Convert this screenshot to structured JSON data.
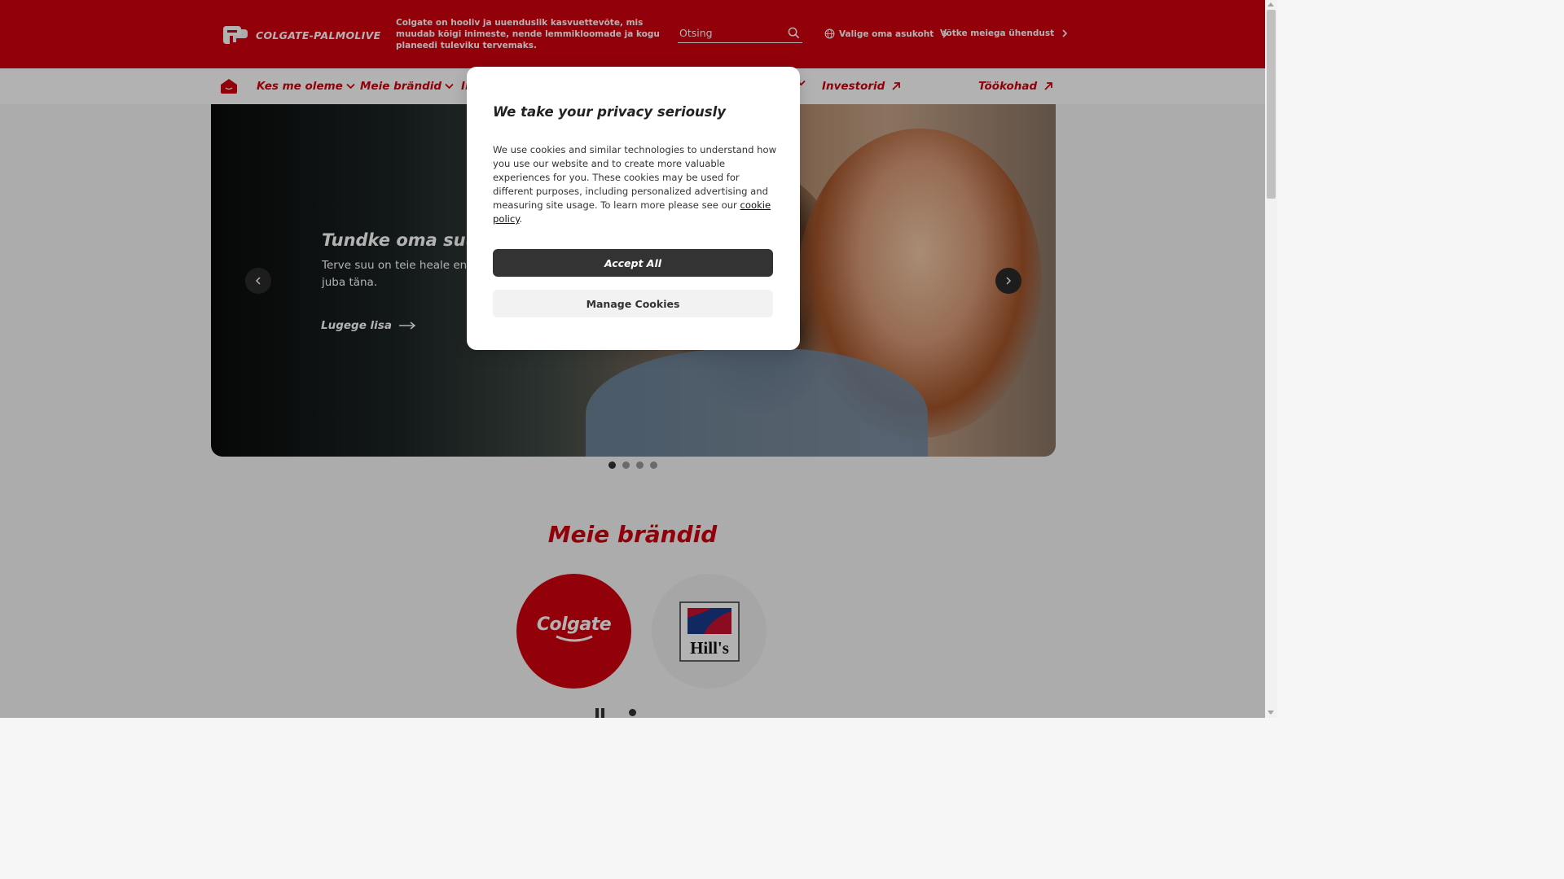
{
  "header": {
    "logo_text": "COLGATE-PALMOLIVE",
    "tagline": "Colgate on hooliv ja uuenduslik kasvuettevõte, mis muudab kõigi inimeste, nende lemmikloomade ja kogu planeedi tuleviku tervemaks.",
    "search_placeholder": "Otsing",
    "location_label": "Valige oma asukoht",
    "contact_label": "Võtke meiega ühendust"
  },
  "nav": {
    "items": [
      {
        "label": "Kes me oleme"
      },
      {
        "label": "Meie brändid"
      },
      {
        "label": "In"
      },
      {
        "label": "Investorid"
      },
      {
        "label": "Töökohad"
      }
    ]
  },
  "hero": {
    "title": "Tundke oma suu",
    "description": "Terve suu on teie heale en selle eest juba täna.",
    "link_label": "Lugege lisa",
    "slide_count": 4,
    "active_slide": 1
  },
  "brands": {
    "title": "Meie brändid",
    "items": [
      {
        "name": "Colgate"
      },
      {
        "name": "Hill's"
      }
    ]
  },
  "cookie_modal": {
    "title": "We take your privacy seriously",
    "body": "We use cookies and similar technologies to understand how you use our website and to create more valuable experiences for you. These cookies may be used for different purposes, including personalized advertising and measuring site usage. To learn more please see our",
    "link_label": "cookie policy",
    "accept_label": "Accept All",
    "manage_label": "Manage Cookies"
  },
  "colors": {
    "brand_red": "#d2010d",
    "dark_button": "#333333",
    "light_button": "#f2f2f2"
  },
  "icons": [
    "logo-mark-icon",
    "search-icon",
    "globe-icon",
    "chevron-right-icon",
    "home-icon",
    "chevron-down-icon",
    "arrow-up-right-icon",
    "chevron-left-icon",
    "arrow-right-icon",
    "pause-icon"
  ]
}
